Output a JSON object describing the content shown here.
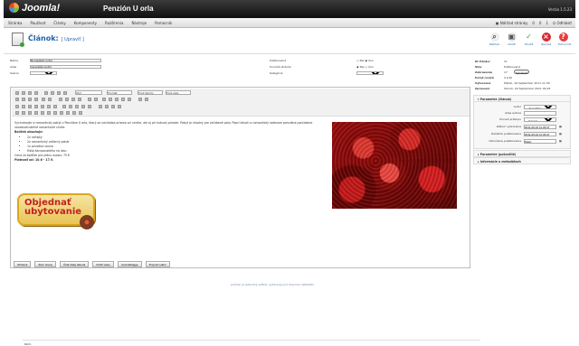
{
  "app": {
    "brand": "Joomla!",
    "site_title": "Penzión U orla",
    "version": "Verzia 1.5.23"
  },
  "menu": [
    "Stránka",
    "Používať",
    "Články",
    "Komponenty",
    "Rozšírenia",
    "Nástroje",
    "Pomocník"
  ],
  "status": {
    "preview": "Náhľad stránky",
    "messages": "0",
    "visitors": "0",
    "admins": "1",
    "logout": "Odhlásiť"
  },
  "header": {
    "title": "Článok:",
    "mode": "[ Upraviť ]"
  },
  "toolbar": [
    {
      "label": "Náhľad",
      "icon": "preview"
    },
    {
      "label": "Uložiť",
      "icon": "save"
    },
    {
      "label": "Použiť",
      "icon": "apply"
    },
    {
      "label": "Zavrieť",
      "icon": "cancel"
    },
    {
      "label": "Pomocník",
      "icon": "help"
    }
  ],
  "form": {
    "title_label": "Názov",
    "title_value": "Romantický pobyt",
    "alias_label": "Alias",
    "alias_value": "romanticky-pobyt",
    "section_label": "Sekcia",
    "section_value": "Bez kategórie",
    "published_label": "Publikované",
    "frontpage_label": "Úvodná stránka",
    "category_label": "Kategória",
    "category_value": "Bez kategórie",
    "no": "Nie",
    "yes": "Áno"
  },
  "editor": {
    "styles_value": "Štýl",
    "format_value": "Formát",
    "font_family_value": "Font family",
    "font_size_value": "Font size",
    "intro": "Vychutnajte si romantický pobyt v Penzióne U orla, ktorý sa nachádza priamo pri centre, ale aj pri krásnej prírode. Pobyt je vhodný pre zaľúbené páry. Popri letoch a romanticky ladenom penzióne ponúkame nezabudnuteľné romantické chvíle.",
    "package_heading": "Balíček obsahuje:",
    "items": [
      "2x raňajky",
      "2x romantický večerný pohár",
      "1x privátna sauna",
      "fľaša šampanského na izbu"
    ],
    "price_text": "Cena za balíček pre jednu osobu: 75 €",
    "valid_text": "Platnosť od: 10.6 - 17.9.",
    "cta": "Objednať ubytovanie",
    "path": "Path:",
    "bottom_buttons": [
      "Obrázok",
      "Zlom strany",
      "Čítať ďalej Hlavná",
      "Vložiť video",
      "JoomlaFlagge",
      "Prepnúť editor"
    ]
  },
  "sidebar": {
    "article_id_label": "ID článku:",
    "article_id_value": "11",
    "state_label": "Stav",
    "state_value": "Publikované",
    "hits_label": "Zobrazenia",
    "hits_value": "17",
    "reset_label": "Vynulovať",
    "revisions_label": "Počet revízií",
    "revisions_value": "4 krát",
    "created_label": "Vytvorené",
    "created_value": "Piatok, 16 September 2011 11:39",
    "modified_label": "Upravené",
    "modified_value": "Utorok, 20 September 2011 09:25",
    "panel_title": "Parametre (článok)",
    "author_label": "Autor",
    "author_value": "Jana Marušič",
    "alias_author_label": "Alias autora",
    "access_label": "Úroveň prístupu",
    "access_value": "Verejné",
    "created_date_label": "Dátum vytvorenia",
    "created_date_value": "2011-09-16 11:39:37",
    "publish_up_label": "Začiatok publikovania",
    "publish_up_value": "2011-09-16 11:39:37",
    "publish_down_label": "Ukončenie publikovania",
    "publish_down_value": "Nikdy",
    "advanced_title": "Parametre (pokročilé)",
    "metadata_title": "Informácie o metadátach"
  },
  "footer": {
    "text": "Joomla! je slobodný softvér vydávaný pod licenciou GNU/GPL."
  }
}
